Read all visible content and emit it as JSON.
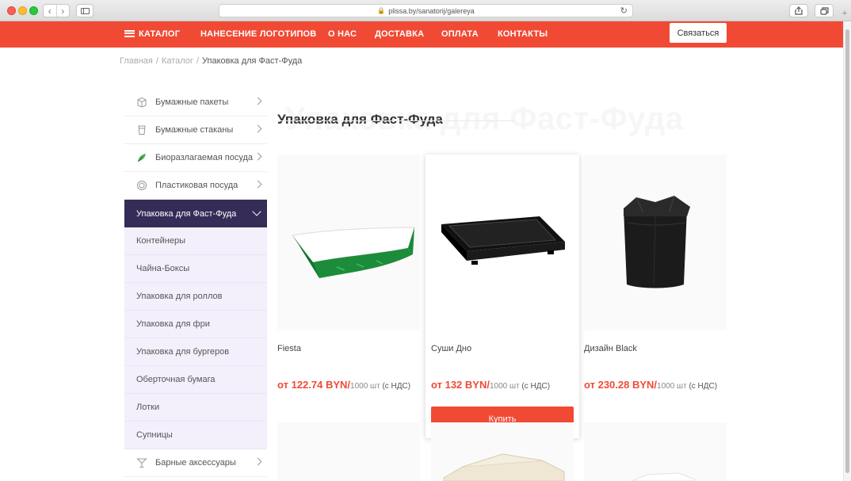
{
  "browser": {
    "url": "plissa.by/sanatorij/galereya"
  },
  "header": {
    "nav": [
      {
        "label": "КАТАЛОГ"
      },
      {
        "label": "НАНЕСЕНИЕ ЛОГОТИПОВ"
      },
      {
        "label": "О НАС"
      },
      {
        "label": "ДОСТАВКА"
      },
      {
        "label": "ОПЛАТА"
      },
      {
        "label": "КОНТАКТЫ"
      }
    ],
    "contact_button": "Связаться",
    "accent_color": "#f14a34"
  },
  "breadcrumb": {
    "home": "Главная",
    "catalog": "Каталог",
    "current": "Упаковка для Фаст-Фуда",
    "separator": "/"
  },
  "sidebar": {
    "categories_top": [
      {
        "label": "Бумажные пакеты",
        "icon": "paper-bag-icon"
      },
      {
        "label": "Бумажные стаканы",
        "icon": "paper-cup-icon"
      },
      {
        "label": "Биоразлагаемая посуда",
        "icon": "leaf-icon"
      },
      {
        "label": "Пластиковая посуда",
        "icon": "plastic-dish-icon"
      }
    ],
    "active": {
      "label": "Упаковка для Фаст-Фуда"
    },
    "subcategories": [
      {
        "label": "Контейнеры"
      },
      {
        "label": "Чайна-Боксы"
      },
      {
        "label": "Упаковка для роллов"
      },
      {
        "label": "Упаковка для фри"
      },
      {
        "label": "Упаковка для бургеров"
      },
      {
        "label": "Оберточная бумага"
      },
      {
        "label": "Лотки"
      },
      {
        "label": "Супницы"
      }
    ],
    "categories_bottom": [
      {
        "label": "Барные аксессуары",
        "icon": "cocktail-glass-icon"
      }
    ],
    "active_color": "#352c57",
    "sub_bg_color": "#f3f0fc"
  },
  "main": {
    "ghost_title": "Упаковка для Фаст-Фуда",
    "title": "Упаковка для Фаст-Фуда",
    "products": [
      {
        "name": "Fiesta",
        "price": "от 122.74 BYN/",
        "unit": "1000 шт",
        "vat": "(с НДС)"
      },
      {
        "name": "Суши Дно",
        "price": "от 132 BYN/",
        "unit": "1000 шт",
        "vat": "(с НДС)",
        "buy_label": "Купить"
      },
      {
        "name": "Дизайн Black",
        "price": "от 230.28 BYN/",
        "unit": "1000 шт",
        "vat": "(с НДС)"
      }
    ]
  }
}
